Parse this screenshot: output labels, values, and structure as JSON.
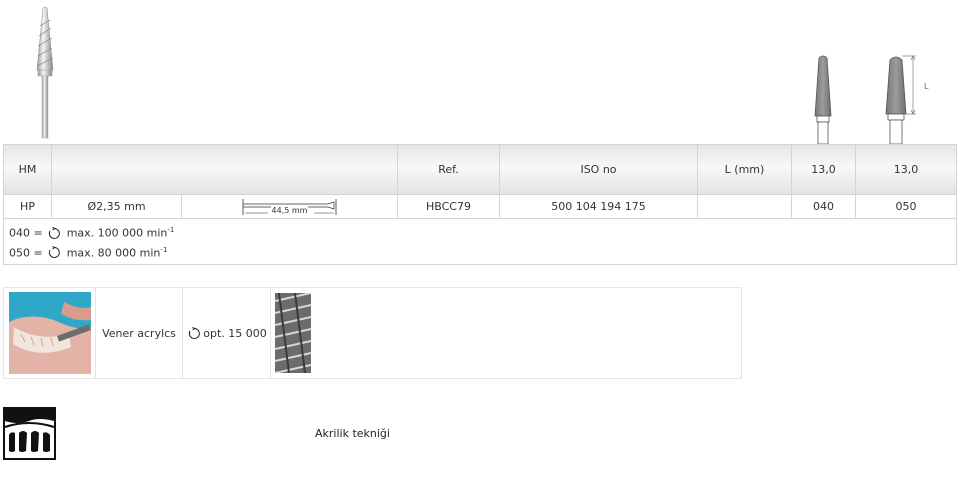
{
  "table": {
    "headers": [
      "HM",
      "",
      "Ref.",
      "ISO no",
      "L (mm)",
      "13,0",
      "13,0"
    ],
    "row": {
      "type": "HP",
      "diameter": "Ø2,35 mm",
      "shank_length": "44,5 mm",
      "ref": "HBCC79",
      "iso": "500 104 194 175",
      "l_mm": "",
      "size1": "040",
      "size2": "050"
    },
    "notes": [
      {
        "prefix": "040 =",
        "text": "max. 100 000 min",
        "sup": "-1"
      },
      {
        "prefix": "050 =",
        "text": "max. 80 000 min",
        "sup": "-1"
      }
    ]
  },
  "dimension_label": "L",
  "application": {
    "name": "Vener acrylcs",
    "speed": "opt. 15 000"
  },
  "technique": {
    "label": "Akrilik tekniği"
  },
  "colors": {
    "header_bg": "#e8e8e8",
    "border": "#d4d4d4",
    "bur_head": "#8a8a8a"
  }
}
